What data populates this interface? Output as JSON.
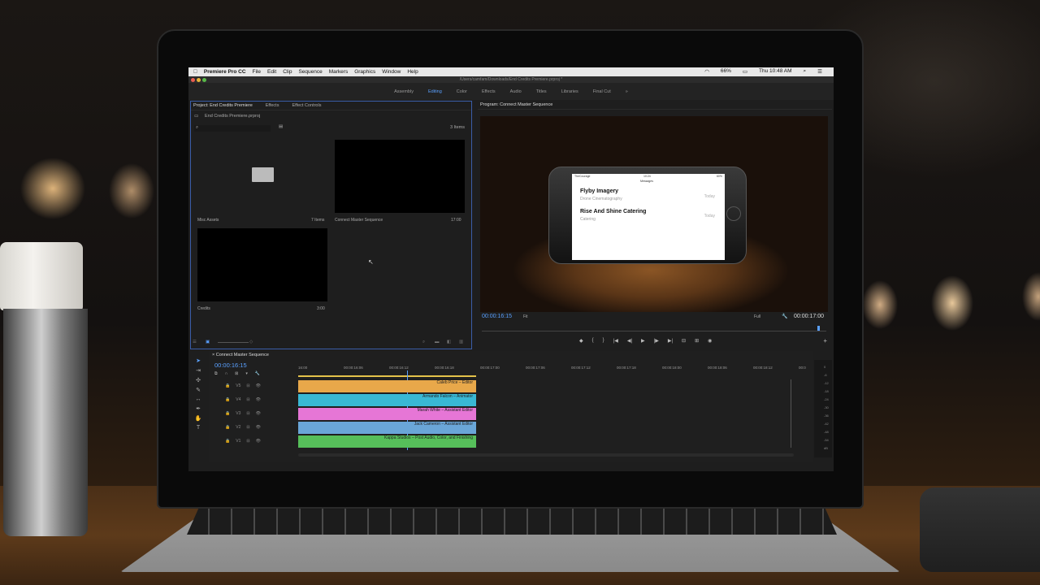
{
  "menubar": {
    "app": "Premiere Pro CC",
    "items": [
      "File",
      "Edit",
      "Clip",
      "Sequence",
      "Markers",
      "Graphics",
      "Window",
      "Help"
    ],
    "battery": "66%",
    "clock": "Thu 10:48 AM"
  },
  "title": "/Users/camfam/Downloads/End Credits Premiere.prproj *",
  "workspaces": [
    "Assembly",
    "Editing",
    "Color",
    "Effects",
    "Audio",
    "Titles",
    "Libraries",
    "Final Cut"
  ],
  "workspace_active": "Editing",
  "project": {
    "tabs": [
      "Project: End Credits Premiere",
      "Effects",
      "Effect Controls"
    ],
    "file": "End Credits Premiere.prproj",
    "count": "3 Items",
    "items": [
      {
        "name": "Misc Assets",
        "meta": "7 Items"
      },
      {
        "name": "Connect Master Sequence",
        "meta": "17:00"
      },
      {
        "name": "Credits",
        "meta": "3:00"
      }
    ]
  },
  "program": {
    "title": "Program: Connect Master Sequence",
    "timecode": "00:00:16:15",
    "fit": "Fit",
    "quality": "Full",
    "duration": "00:00:17:00",
    "phone": {
      "carrier": "TheCourage",
      "time": "10:24",
      "battery": "60%",
      "header": "Messages",
      "messages": [
        {
          "title": "Flyby Imagery",
          "sub": "Drone Cinematography",
          "time": "Today"
        },
        {
          "title": "Rise And Shine Catering",
          "sub": "Catering",
          "time": "Today"
        }
      ]
    }
  },
  "timeline": {
    "title": "Connect Master Sequence",
    "timecode": "00:00:16:15",
    "ruler": [
      "16:00",
      "00:00:16:06",
      "00:00:16:12",
      "00:00:16:18",
      "00:00:17:00",
      "00:00:17:06",
      "00:00:17:12",
      "00:00:17:18",
      "00:00:18:00",
      "00:00:18:06",
      "00:00:18:12",
      "00:0"
    ],
    "tracks": [
      {
        "name": "V5",
        "label": "Caleb Price – Editor",
        "color": "#e8a84a"
      },
      {
        "name": "V4",
        "label": "Armando Falcon – Animator",
        "color": "#39b8d4"
      },
      {
        "name": "V3",
        "label": "Marah White – Assistant Editor",
        "color": "#e676d6"
      },
      {
        "name": "V2",
        "label": "Jack Cameron – Assistant Editor",
        "color": "#6aa6d8"
      },
      {
        "name": "V1",
        "label": "Kappa Studios – Post Audio, Color, and Finishing",
        "color": "#56bf5a"
      }
    ],
    "meter_labels": [
      "0",
      "-6",
      "-12",
      "-18",
      "-24",
      "-30",
      "-36",
      "-42",
      "-48",
      "-54",
      "dB"
    ]
  }
}
